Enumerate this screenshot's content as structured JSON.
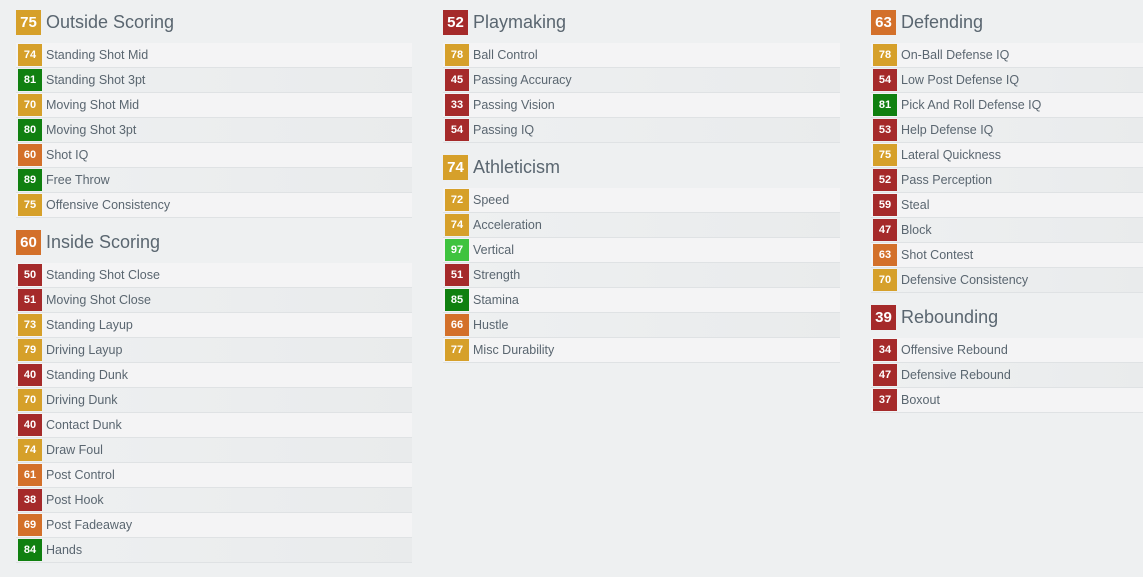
{
  "colors": {
    "elite": "#3fc33f",
    "great": "#108010",
    "good": "#d6a02a",
    "average": "#d3702a",
    "poor": "#a52a2a"
  },
  "columns": [
    {
      "categories": [
        {
          "name": "Outside Scoring",
          "rating": "75",
          "tier": "good",
          "attributes": [
            {
              "name": "Standing Shot Mid",
              "rating": "74",
              "tier": "good"
            },
            {
              "name": "Standing Shot 3pt",
              "rating": "81",
              "tier": "great"
            },
            {
              "name": "Moving Shot Mid",
              "rating": "70",
              "tier": "good"
            },
            {
              "name": "Moving Shot 3pt",
              "rating": "80",
              "tier": "great"
            },
            {
              "name": "Shot IQ",
              "rating": "60",
              "tier": "average"
            },
            {
              "name": "Free Throw",
              "rating": "89",
              "tier": "great"
            },
            {
              "name": "Offensive Consistency",
              "rating": "75",
              "tier": "good"
            }
          ]
        },
        {
          "name": "Inside Scoring",
          "rating": "60",
          "tier": "average",
          "attributes": [
            {
              "name": "Standing Shot Close",
              "rating": "50",
              "tier": "poor"
            },
            {
              "name": "Moving Shot Close",
              "rating": "51",
              "tier": "poor"
            },
            {
              "name": "Standing Layup",
              "rating": "73",
              "tier": "good"
            },
            {
              "name": "Driving Layup",
              "rating": "79",
              "tier": "good"
            },
            {
              "name": "Standing Dunk",
              "rating": "40",
              "tier": "poor"
            },
            {
              "name": "Driving Dunk",
              "rating": "70",
              "tier": "good"
            },
            {
              "name": "Contact Dunk",
              "rating": "40",
              "tier": "poor"
            },
            {
              "name": "Draw Foul",
              "rating": "74",
              "tier": "good"
            },
            {
              "name": "Post Control",
              "rating": "61",
              "tier": "average"
            },
            {
              "name": "Post Hook",
              "rating": "38",
              "tier": "poor"
            },
            {
              "name": "Post Fadeaway",
              "rating": "69",
              "tier": "average"
            },
            {
              "name": "Hands",
              "rating": "84",
              "tier": "great"
            }
          ]
        }
      ]
    },
    {
      "categories": [
        {
          "name": "Playmaking",
          "rating": "52",
          "tier": "poor",
          "attributes": [
            {
              "name": "Ball Control",
              "rating": "78",
              "tier": "good"
            },
            {
              "name": "Passing Accuracy",
              "rating": "45",
              "tier": "poor"
            },
            {
              "name": "Passing Vision",
              "rating": "33",
              "tier": "poor"
            },
            {
              "name": "Passing IQ",
              "rating": "54",
              "tier": "poor"
            }
          ]
        },
        {
          "name": "Athleticism",
          "rating": "74",
          "tier": "good",
          "attributes": [
            {
              "name": "Speed",
              "rating": "72",
              "tier": "good"
            },
            {
              "name": "Acceleration",
              "rating": "74",
              "tier": "good"
            },
            {
              "name": "Vertical",
              "rating": "97",
              "tier": "elite"
            },
            {
              "name": "Strength",
              "rating": "51",
              "tier": "poor"
            },
            {
              "name": "Stamina",
              "rating": "85",
              "tier": "great"
            },
            {
              "name": "Hustle",
              "rating": "66",
              "tier": "average"
            },
            {
              "name": "Misc Durability",
              "rating": "77",
              "tier": "good"
            }
          ]
        }
      ]
    },
    {
      "categories": [
        {
          "name": "Defending",
          "rating": "63",
          "tier": "average",
          "attributes": [
            {
              "name": "On-Ball Defense IQ",
              "rating": "78",
              "tier": "good"
            },
            {
              "name": "Low Post Defense IQ",
              "rating": "54",
              "tier": "poor"
            },
            {
              "name": "Pick And Roll Defense IQ",
              "rating": "81",
              "tier": "great"
            },
            {
              "name": "Help Defense IQ",
              "rating": "53",
              "tier": "poor"
            },
            {
              "name": "Lateral Quickness",
              "rating": "75",
              "tier": "good"
            },
            {
              "name": "Pass Perception",
              "rating": "52",
              "tier": "poor"
            },
            {
              "name": "Steal",
              "rating": "59",
              "tier": "poor"
            },
            {
              "name": "Block",
              "rating": "47",
              "tier": "poor"
            },
            {
              "name": "Shot Contest",
              "rating": "63",
              "tier": "average"
            },
            {
              "name": "Defensive Consistency",
              "rating": "70",
              "tier": "good"
            }
          ]
        },
        {
          "name": "Rebounding",
          "rating": "39",
          "tier": "poor",
          "attributes": [
            {
              "name": "Offensive Rebound",
              "rating": "34",
              "tier": "poor"
            },
            {
              "name": "Defensive Rebound",
              "rating": "47",
              "tier": "poor"
            },
            {
              "name": "Boxout",
              "rating": "37",
              "tier": "poor"
            }
          ]
        }
      ]
    }
  ]
}
